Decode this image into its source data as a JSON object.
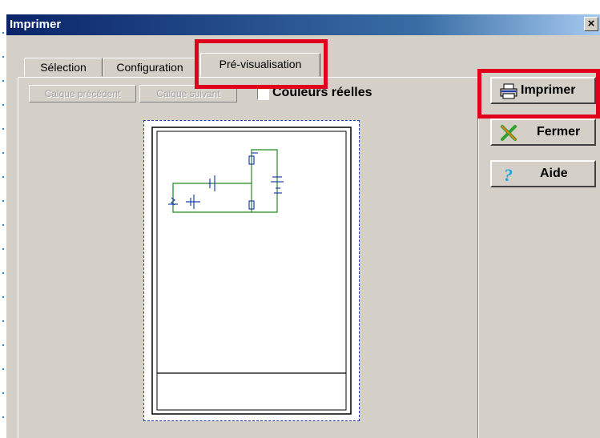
{
  "window": {
    "title": "Imprimer",
    "close_glyph": "×"
  },
  "tabs": [
    {
      "label": "Sélection"
    },
    {
      "label": "Configuration"
    },
    {
      "label": "Pré-visualisation",
      "active": true
    }
  ],
  "preview_panel": {
    "prev_layer_label": "Calque précédent",
    "next_layer_label": "Calque suivant",
    "real_colors_label": "Couleurs réelles",
    "real_colors_checked": false
  },
  "actions": {
    "print_label": "Imprimer",
    "close_label": "Fermer",
    "help_label": "Aide"
  },
  "icons": {
    "print": "printer-icon",
    "close": "x-cross-icon",
    "help": "question-mark-icon"
  },
  "colors": {
    "titlebar": "#0a246a",
    "highlight": "#e0001b",
    "circuit": "#1f8a1f",
    "preview_border": "#1f3fb0",
    "dialog_bg": "#d4d0c8"
  }
}
